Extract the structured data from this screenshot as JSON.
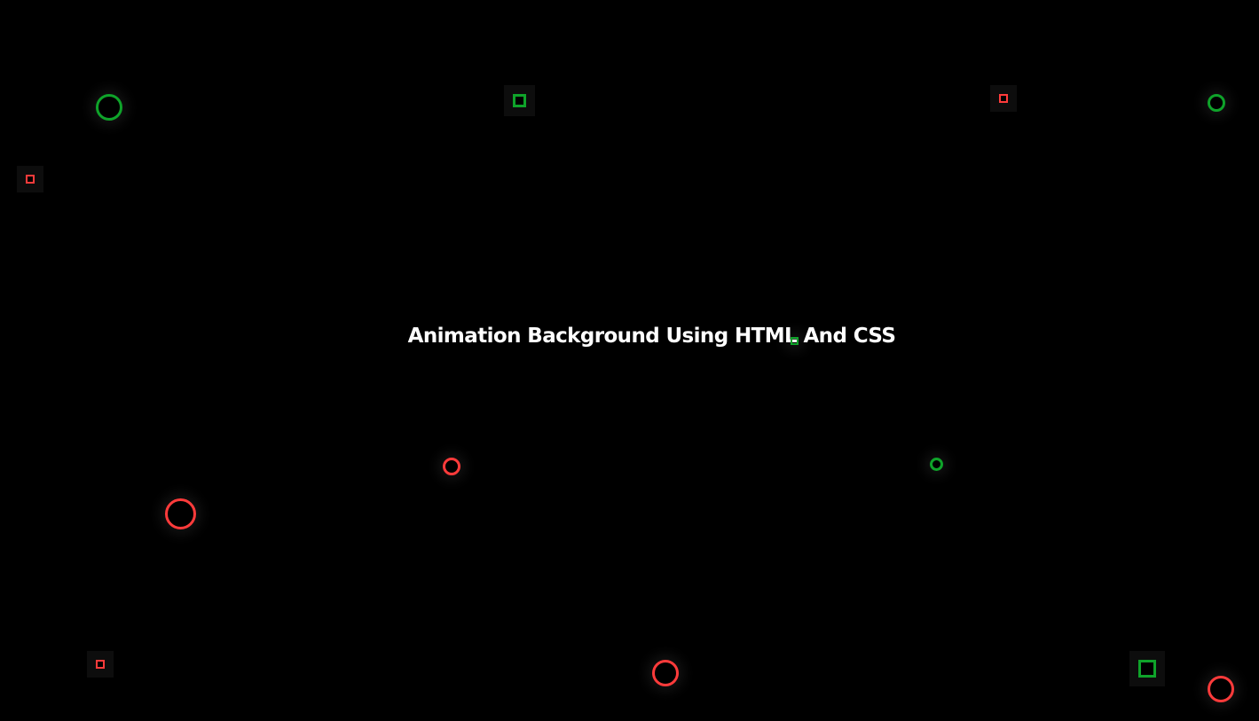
{
  "title": "Animation Background Using HTML And CSS",
  "colors": {
    "background": "#000000",
    "text": "#ffffff",
    "red": "#ff3b3b",
    "green": "#0fa32a"
  }
}
